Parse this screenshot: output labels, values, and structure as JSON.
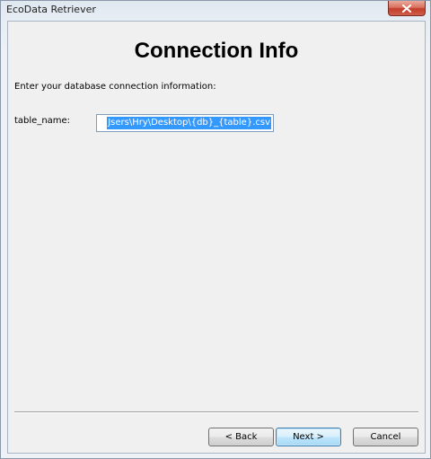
{
  "window": {
    "title": "EcoData Retriever"
  },
  "page": {
    "heading": "Connection Info",
    "instruction": "Enter your database connection information:"
  },
  "fields": [
    {
      "label": "table_name:",
      "value": "Jsers\\Hry\\Desktop\\{db}_{table}.csv"
    }
  ],
  "buttons": {
    "back": "< Back",
    "next": "Next >",
    "cancel": "Cancel"
  },
  "icons": {
    "close": "close-icon"
  }
}
